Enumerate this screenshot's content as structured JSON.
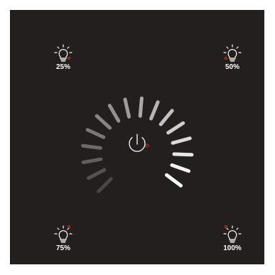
{
  "presets": [
    {
      "label": "25%",
      "value": 25,
      "icon": "lightbulb-icon"
    },
    {
      "label": "50%",
      "value": 50,
      "icon": "lightbulb-icon"
    },
    {
      "label": "75%",
      "value": 75,
      "icon": "lightbulb-icon"
    },
    {
      "label": "100%",
      "value": 100,
      "icon": "lightbulb-icon"
    }
  ],
  "dial": {
    "segments": 16,
    "icon": "power-icon"
  },
  "colors": {
    "panel": "#231f1e",
    "text": "#ffffff",
    "indicator": "#c8342c",
    "segment_dim": "#4a4544",
    "segment_bright": "#ffffff"
  }
}
